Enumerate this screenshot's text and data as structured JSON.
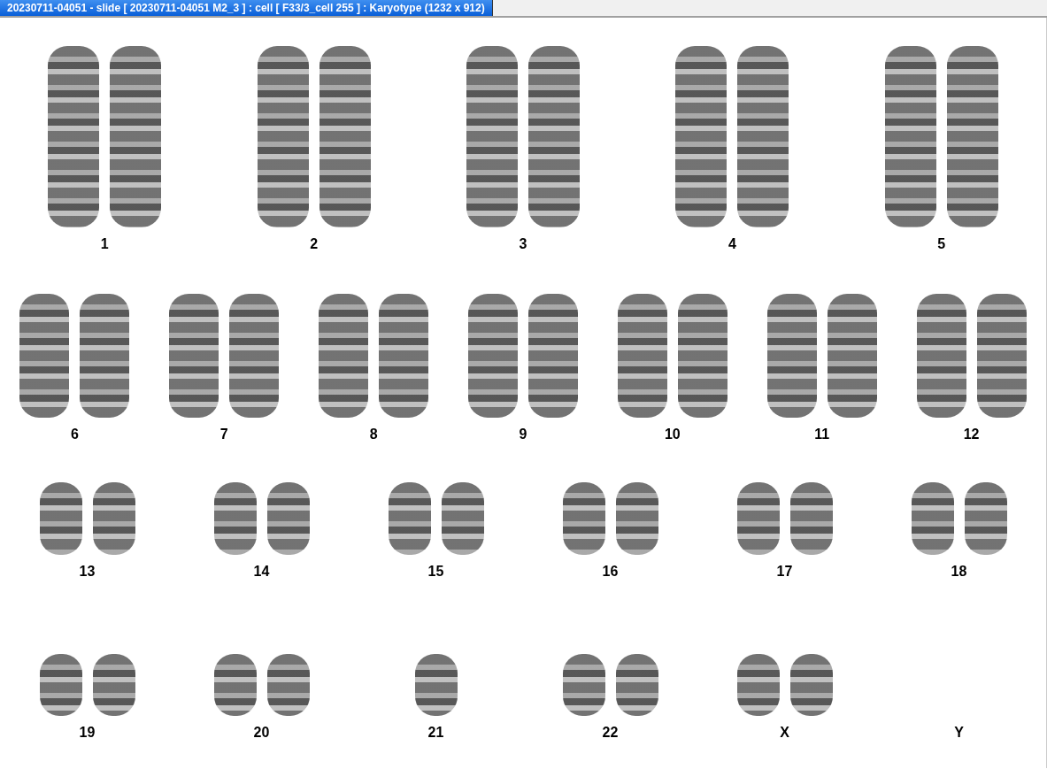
{
  "window": {
    "title": "20230711-04051 - slide [ 20230711-04051 M2_3 ] : cell [ F33/3_cell 255 ] : Karyotype  (1232 x 912)"
  },
  "karyotype": {
    "rows": [
      {
        "groups": [
          {
            "label": "1",
            "kind": "pair"
          },
          {
            "label": "2",
            "kind": "pair"
          },
          {
            "label": "3",
            "kind": "pair"
          },
          {
            "label": "4",
            "kind": "pair"
          },
          {
            "label": "5",
            "kind": "pair"
          }
        ]
      },
      {
        "groups": [
          {
            "label": "6",
            "kind": "pair"
          },
          {
            "label": "7",
            "kind": "pair"
          },
          {
            "label": "8",
            "kind": "pair"
          },
          {
            "label": "9",
            "kind": "pair"
          },
          {
            "label": "10",
            "kind": "pair"
          },
          {
            "label": "11",
            "kind": "pair"
          },
          {
            "label": "12",
            "kind": "pair"
          }
        ]
      },
      {
        "groups": [
          {
            "label": "13",
            "kind": "pair"
          },
          {
            "label": "14",
            "kind": "pair"
          },
          {
            "label": "15",
            "kind": "pair"
          },
          {
            "label": "16",
            "kind": "pair"
          },
          {
            "label": "17",
            "kind": "pair"
          },
          {
            "label": "18",
            "kind": "pair"
          }
        ]
      },
      {
        "groups": [
          {
            "label": "19",
            "kind": "pair"
          },
          {
            "label": "20",
            "kind": "pair"
          },
          {
            "label": "21",
            "kind": "single"
          },
          {
            "label": "22",
            "kind": "pair"
          },
          {
            "label": "X",
            "kind": "pair"
          },
          {
            "label": "Y",
            "kind": "empty"
          }
        ]
      }
    ]
  }
}
